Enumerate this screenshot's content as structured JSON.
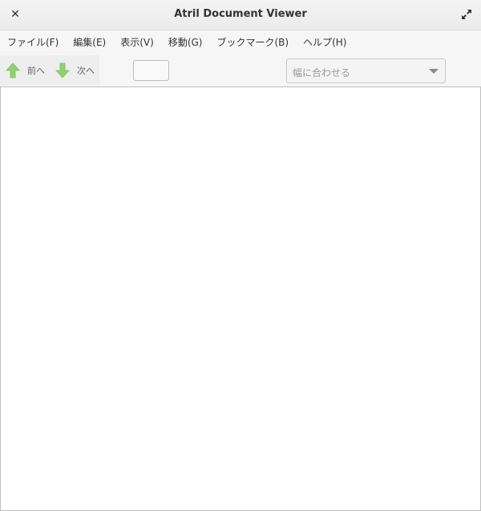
{
  "window": {
    "title": "Atril Document Viewer"
  },
  "menubar": {
    "items": [
      "ファイル(F)",
      "編集(E)",
      "表示(V)",
      "移動(G)",
      "ブックマーク(B)",
      "ヘルプ(H)"
    ]
  },
  "toolbar": {
    "prev_label": "前へ",
    "next_label": "次へ",
    "page_entry_value": "",
    "zoom_selected": "幅に合わせる",
    "arrow_color": "#8fd16c"
  },
  "icons": {
    "close": "close-icon",
    "maximize": "maximize-icon",
    "prev": "arrow-up-icon",
    "next": "arrow-down-icon",
    "dropdown": "chevron-down-icon"
  }
}
